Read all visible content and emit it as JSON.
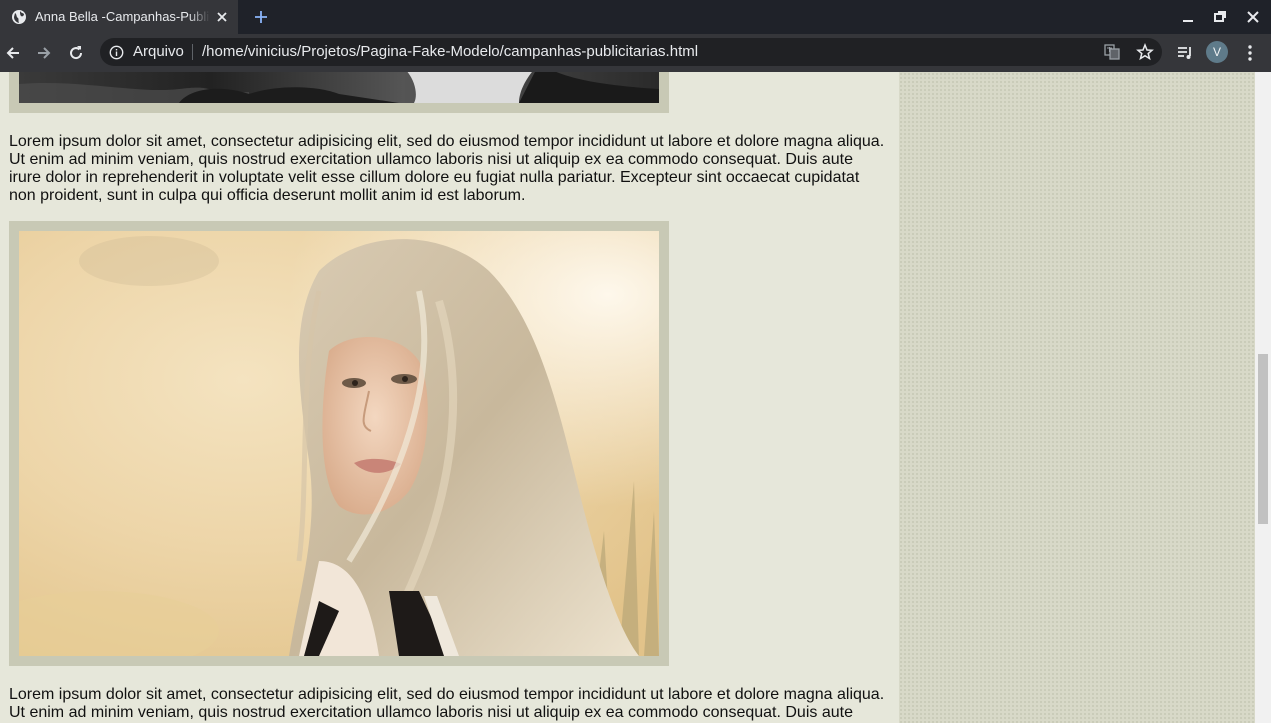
{
  "browser": {
    "tab_title": "Anna Bella -Campanhas-Publicitarias",
    "address_scheme": "Arquivo",
    "address_url": "/home/vinicius/Projetos/Pagina-Fake-Modelo/campanhas-publicitarias.html",
    "profile_initial": "V",
    "icons": [
      "globe-icon",
      "close-icon",
      "plus-icon",
      "minimize-icon",
      "restore-icon",
      "window-close-icon",
      "back-icon",
      "forward-icon",
      "reload-icon",
      "info-icon",
      "translate-icon",
      "star-icon",
      "media-queue-icon",
      "kebab-menu-icon"
    ]
  },
  "page": {
    "paragraphs": [
      "Lorem ipsum dolor sit amet, consectetur adipisicing elit, sed do eiusmod tempor incididunt ut labore et dolore magna aliqua. Ut enim ad minim veniam, quis nostrud exercitation ullamco laboris nisi ut aliquip ex ea commodo consequat. Duis aute irure dolor in reprehenderit in voluptate velit esse cillum dolore eu fugiat nulla pariatur. Excepteur sint occaecat cupidatat non proident, sunt in culpa qui officia deserunt mollit anim id est laborum.",
      "Lorem ipsum dolor sit amet, consectetur adipisicing elit, sed do eiusmod tempor incididunt ut labore et dolore magna aliqua. Ut enim ad minim veniam, quis nostrud exercitation ullamco laboris nisi ut aliquip ex ea commodo consequat. Duis aute irure dolor in reprehenderit in voluptate velit esse cillum dolore eu fugiat nulla pariatur. Excepteur sint occaecat cupidatat non proident, sunt in culpa qui officia deserunt mollit anim id est laborum."
    ]
  },
  "colors": {
    "chrome_dark": "#1f2229",
    "chrome_tab": "#35363a",
    "page_bg": "#e6e7da",
    "photo_frame": "#c8c9b5",
    "sidebar_pattern": "#d8d9c8"
  }
}
